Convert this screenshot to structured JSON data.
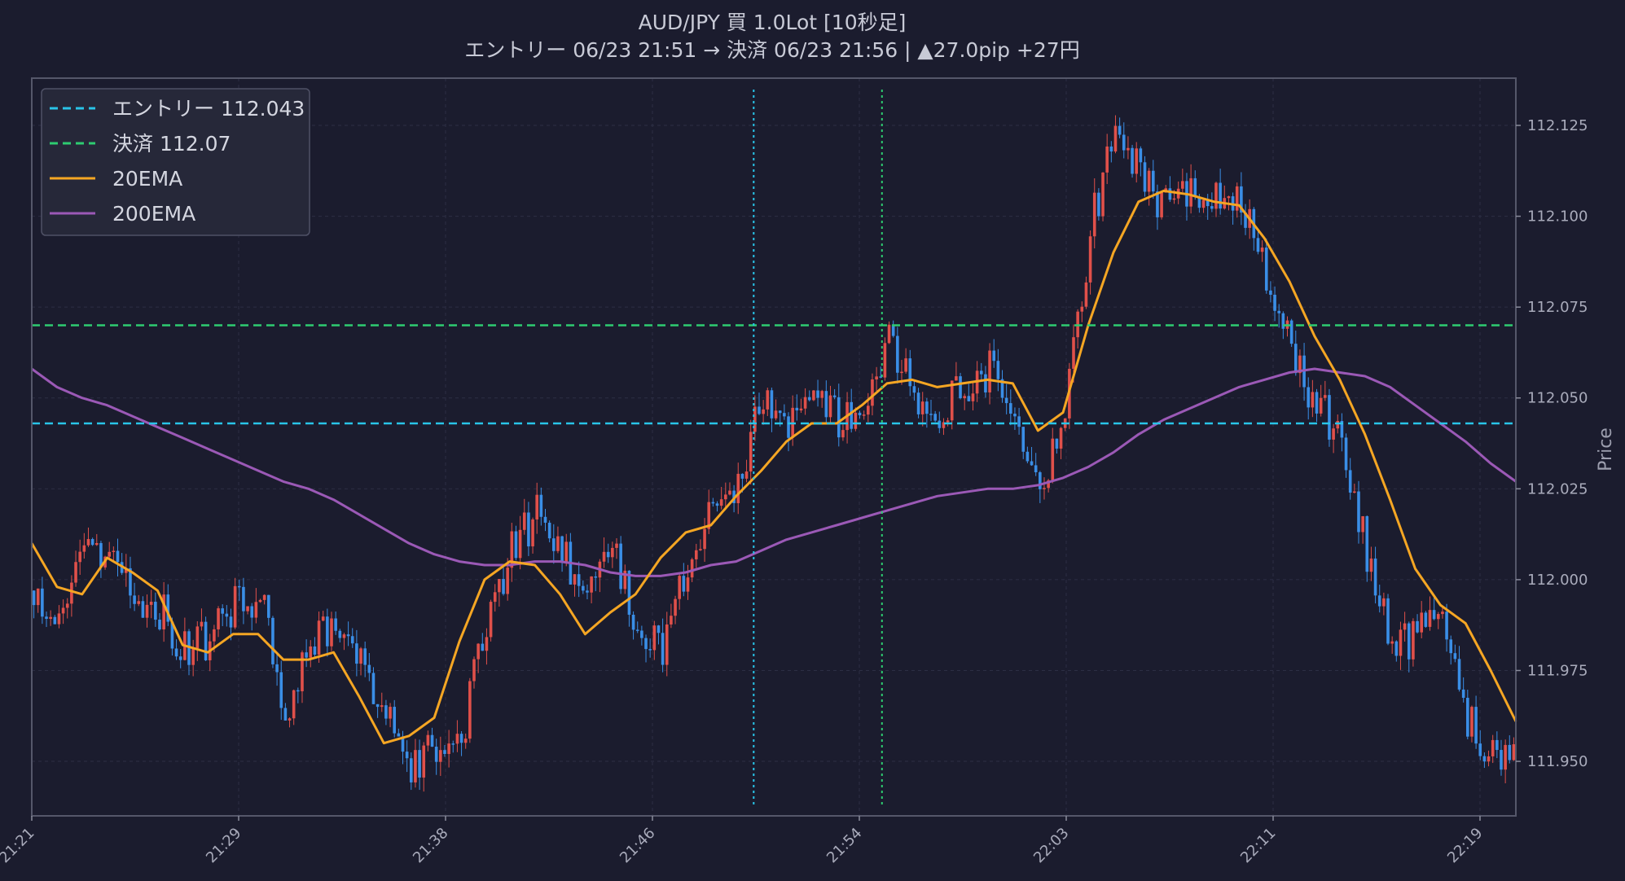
{
  "chart_data": {
    "type": "candlestick",
    "title": "AUD/JPY  買  1.0Lot  [10秒足]",
    "subtitle": "エントリー 06/23 21:51  →  決済 06/23 21:56  |  ▲27.0pip  +27円",
    "ylabel": "Price",
    "ylim": [
      111.935,
      112.138
    ],
    "y_ticks": [
      "111.950",
      "111.975",
      "112.000",
      "112.025",
      "112.050",
      "112.075",
      "112.100",
      "112.125"
    ],
    "x_ticks": [
      "21:21",
      "21:29",
      "21:38",
      "21:46",
      "21:54",
      "22:03",
      "22:11",
      "22:19"
    ],
    "grid": true,
    "legend_position": "top-left",
    "legend": [
      {
        "label": "エントリー 112.043",
        "style": "dashed",
        "color": "#29c4e8"
      },
      {
        "label": "決済 112.07",
        "style": "dashed",
        "color": "#2ecc71"
      },
      {
        "label": "20EMA",
        "style": "solid",
        "color": "#f5a623"
      },
      {
        "label": "200EMA",
        "style": "solid",
        "color": "#9b59b6"
      }
    ],
    "entry_price": 112.043,
    "exit_price": 112.07,
    "entry_time_index": 28.7,
    "exit_time_index": 33.8,
    "colors": {
      "up": "#e0504a",
      "down": "#3a8ee6",
      "background": "#1b1c2e",
      "grid": "#2c2e44"
    },
    "price_path": [
      111.997,
      111.985,
      112.008,
      112.004,
      111.995,
      111.992,
      111.981,
      111.984,
      111.993,
      111.996,
      111.965,
      111.98,
      111.991,
      111.976,
      111.962,
      111.946,
      111.955,
      111.957,
      111.988,
      112.009,
      112.018,
      112.005,
      112.002,
      112.01,
      111.986,
      111.98,
      112.003,
      112.019,
      112.026,
      112.05,
      112.04,
      112.055,
      112.044,
      112.048,
      112.068,
      112.052,
      112.046,
      112.053,
      112.058,
      112.047,
      112.024,
      112.044,
      112.095,
      112.128,
      112.11,
      112.102,
      112.105,
      112.108,
      112.103,
      112.085,
      112.062,
      112.049,
      112.04,
      112.008,
      111.982,
      111.985,
      111.987,
      111.962,
      111.95,
      111.957
    ],
    "ema20": [
      112.01,
      111.998,
      111.996,
      112.006,
      112.002,
      111.997,
      111.982,
      111.98,
      111.985,
      111.985,
      111.978,
      111.978,
      111.98,
      111.968,
      111.955,
      111.957,
      111.962,
      111.983,
      112.0,
      112.005,
      112.004,
      111.996,
      111.985,
      111.991,
      111.996,
      112.006,
      112.013,
      112.015,
      112.023,
      112.03,
      112.038,
      112.043,
      112.043,
      112.048,
      112.054,
      112.055,
      112.053,
      112.054,
      112.055,
      112.054,
      112.041,
      112.046,
      112.07,
      112.09,
      112.104,
      112.107,
      112.106,
      112.104,
      112.103,
      112.094,
      112.082,
      112.067,
      112.055,
      112.04,
      112.022,
      112.003,
      111.993,
      111.988,
      111.975,
      111.961
    ],
    "ema200": [
      112.058,
      112.053,
      112.05,
      112.048,
      112.045,
      112.042,
      112.039,
      112.036,
      112.033,
      112.03,
      112.027,
      112.025,
      112.022,
      112.018,
      112.014,
      112.01,
      112.007,
      112.005,
      112.004,
      112.004,
      112.005,
      112.005,
      112.004,
      112.002,
      112.001,
      112.001,
      112.002,
      112.004,
      112.005,
      112.008,
      112.011,
      112.013,
      112.015,
      112.017,
      112.019,
      112.021,
      112.023,
      112.024,
      112.025,
      112.025,
      112.026,
      112.028,
      112.031,
      112.035,
      112.04,
      112.044,
      112.047,
      112.05,
      112.053,
      112.055,
      112.057,
      112.058,
      112.057,
      112.056,
      112.053,
      112.048,
      112.043,
      112.038,
      112.032,
      112.027
    ]
  }
}
